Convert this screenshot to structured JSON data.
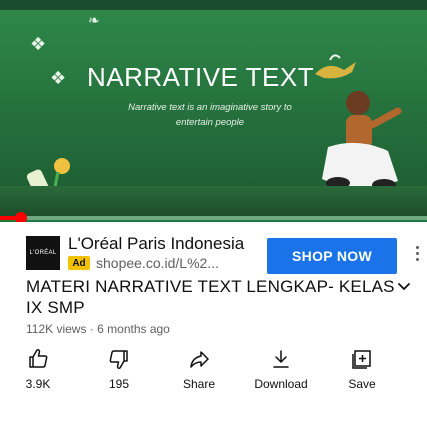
{
  "video": {
    "title_text": "NARRATIVE TEXT",
    "subtitle_text": "Narrative text is an imaginative story to entertain people",
    "progress_percent": 5,
    "colors": {
      "board": "#256f3c",
      "progress": "#ff0000"
    }
  },
  "ad": {
    "logo_text": "L'ORÉAL",
    "advertiser": "L'Oréal Paris Indonesia",
    "badge": "Ad",
    "url": "shopee.co.id/L%2...",
    "cta_label": "SHOP NOW",
    "colors": {
      "cta": "#1a73e8",
      "badge": "#f2c200"
    }
  },
  "details": {
    "title": "MATERI NARRATIVE TEXT LENGKAP- KELAS IX SMP",
    "meta": "112K views · 6 months ago"
  },
  "actions": [
    {
      "icon": "thumbs-up-icon",
      "label": "3.9K"
    },
    {
      "icon": "thumbs-down-icon",
      "label": "195"
    },
    {
      "icon": "share-icon",
      "label": "Share"
    },
    {
      "icon": "download-icon",
      "label": "Download"
    },
    {
      "icon": "save-icon",
      "label": "Save"
    }
  ]
}
